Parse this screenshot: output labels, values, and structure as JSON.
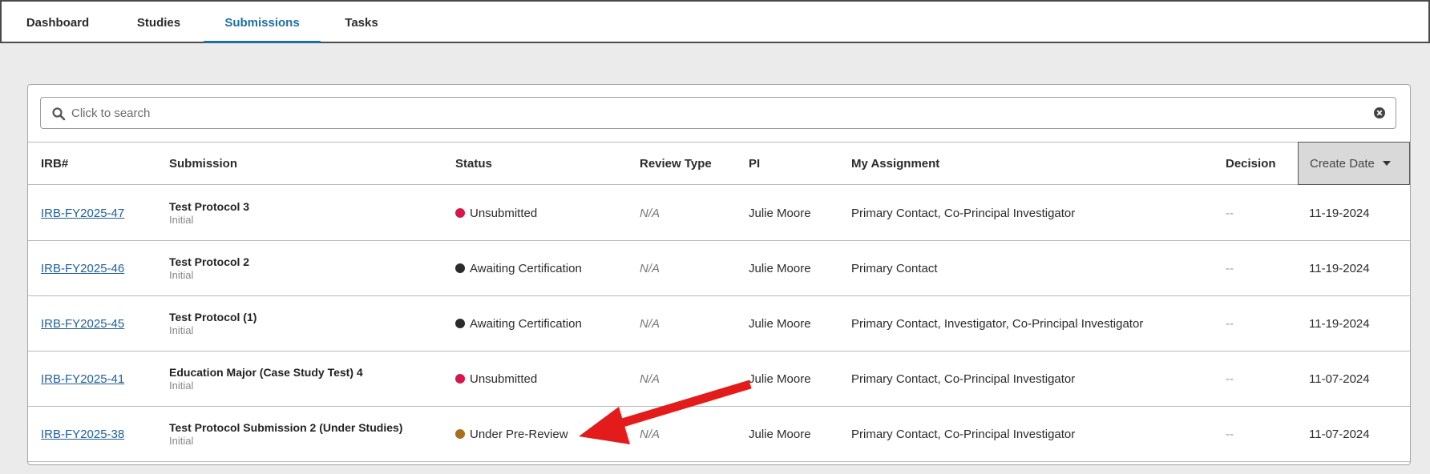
{
  "nav": {
    "tabs": [
      {
        "label": "Dashboard"
      },
      {
        "label": "Studies"
      },
      {
        "label": "Submissions"
      },
      {
        "label": "Tasks"
      }
    ],
    "active": "Submissions"
  },
  "search": {
    "placeholder": "Click to search",
    "value": ""
  },
  "table": {
    "headers": {
      "irb": "IRB#",
      "submission": "Submission",
      "status": "Status",
      "review_type": "Review Type",
      "pi": "PI",
      "assignment": "My Assignment",
      "decision": "Decision",
      "create_date": "Create Date"
    },
    "sort": {
      "column": "Create Date",
      "direction": "descending"
    },
    "rows": [
      {
        "irb": "IRB-FY2025-47",
        "title": "Test Protocol 3",
        "kind": "Initial",
        "status": "Unsubmitted",
        "status_color": "#d6174e",
        "review_type": "N/A",
        "pi": "Julie Moore",
        "assignment": "Primary Contact, Co-Principal Investigator",
        "decision": "--",
        "date": "11-19-2024"
      },
      {
        "irb": "IRB-FY2025-46",
        "title": "Test Protocol 2",
        "kind": "Initial",
        "status": "Awaiting Certification",
        "status_color": "#2b2b2b",
        "review_type": "N/A",
        "pi": "Julie Moore",
        "assignment": "Primary Contact",
        "decision": "--",
        "date": "11-19-2024"
      },
      {
        "irb": "IRB-FY2025-45",
        "title": "Test Protocol (1)",
        "kind": "Initial",
        "status": "Awaiting Certification",
        "status_color": "#2b2b2b",
        "review_type": "N/A",
        "pi": "Julie Moore",
        "assignment": "Primary Contact, Investigator, Co-Principal Investigator",
        "decision": "--",
        "date": "11-19-2024"
      },
      {
        "irb": "IRB-FY2025-41",
        "title": "Education Major (Case Study Test) 4",
        "kind": "Initial",
        "status": "Unsubmitted",
        "status_color": "#d6174e",
        "review_type": "N/A",
        "pi": "Julie Moore",
        "assignment": "Primary Contact, Co-Principal Investigator",
        "decision": "--",
        "date": "11-07-2024"
      },
      {
        "irb": "IRB-FY2025-38",
        "title": "Test Protocol Submission 2 (Under Studies)",
        "kind": "Initial",
        "status": "Under Pre-Review",
        "status_color": "#a8701e",
        "review_type": "N/A",
        "pi": "Julie Moore",
        "assignment": "Primary Contact, Co-Principal Investigator",
        "decision": "--",
        "date": "11-07-2024"
      }
    ]
  },
  "colors": {
    "accent": "#1f6fa3",
    "arrow": "#e31b1b"
  }
}
